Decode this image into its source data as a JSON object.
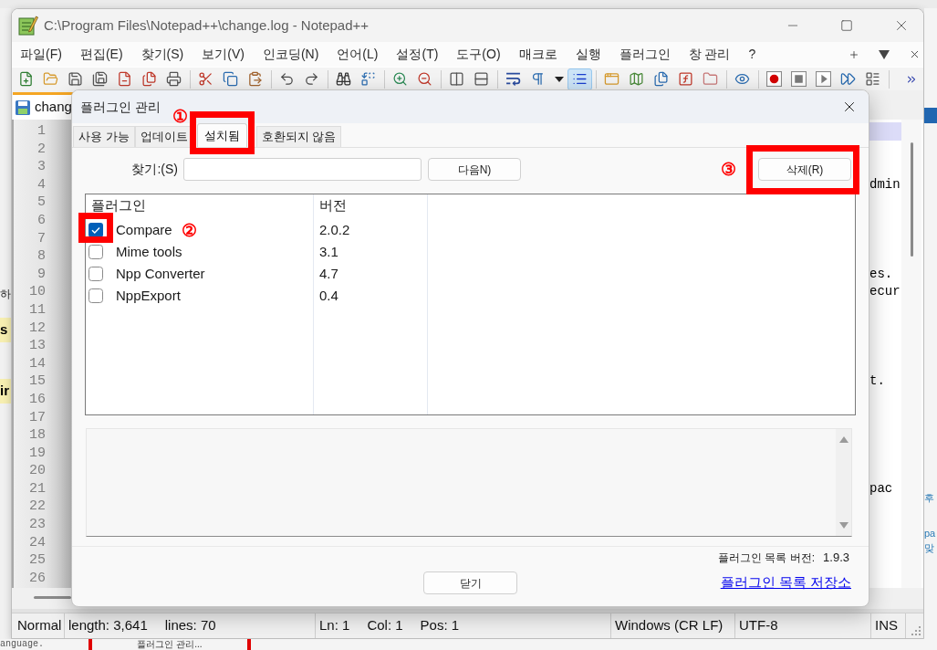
{
  "background": {
    "left_texts": [
      {
        "text": "하",
        "highlighted": false
      },
      {
        "text": "s",
        "highlighted": true
      },
      {
        "text": "ir",
        "highlighted": true
      }
    ],
    "right_texts": [
      "후",
      "pa",
      "맞"
    ],
    "bottom_text": "anguage.",
    "bottom_menu_item": "플러그인 관리..."
  },
  "window": {
    "title": "C:\\Program Files\\Notepad++\\change.log - Notepad++"
  },
  "menu": [
    "파일(F)",
    "편집(E)",
    "찾기(S)",
    "보기(V)",
    "인코딩(N)",
    "언어(L)",
    "설정(T)",
    "도구(O)",
    "매크로",
    "실행",
    "플러그인",
    "창 관리",
    "?"
  ],
  "toolbar": [
    {
      "kind": "button",
      "pressed": false
    },
    {
      "kind": "button",
      "pressed": false
    },
    {
      "kind": "button",
      "pressed": false
    },
    {
      "kind": "button",
      "pressed": false
    },
    {
      "kind": "button",
      "pressed": false
    },
    {
      "kind": "button",
      "pressed": false
    },
    {
      "kind": "button",
      "pressed": false
    },
    {
      "kind": "separator"
    },
    {
      "kind": "button",
      "pressed": false
    },
    {
      "kind": "button",
      "pressed": false
    },
    {
      "kind": "button",
      "pressed": false
    },
    {
      "kind": "separator"
    },
    {
      "kind": "button",
      "pressed": false
    },
    {
      "kind": "button",
      "pressed": false
    },
    {
      "kind": "separator"
    },
    {
      "kind": "button",
      "pressed": false
    },
    {
      "kind": "button",
      "pressed": false
    },
    {
      "kind": "separator"
    },
    {
      "kind": "button",
      "pressed": false
    },
    {
      "kind": "button",
      "pressed": false
    },
    {
      "kind": "separator"
    },
    {
      "kind": "button",
      "pressed": false
    },
    {
      "kind": "button",
      "pressed": false
    },
    {
      "kind": "separator"
    },
    {
      "kind": "button",
      "pressed": false
    },
    {
      "kind": "button",
      "pressed": false
    },
    {
      "kind": "dropdown"
    },
    {
      "kind": "button",
      "pressed": true
    },
    {
      "kind": "separator"
    },
    {
      "kind": "button",
      "pressed": false
    },
    {
      "kind": "button",
      "pressed": false
    },
    {
      "kind": "button",
      "pressed": false
    },
    {
      "kind": "button",
      "pressed": false
    },
    {
      "kind": "button",
      "pressed": false
    },
    {
      "kind": "separator"
    },
    {
      "kind": "button",
      "pressed": false
    },
    {
      "kind": "separator"
    },
    {
      "kind": "button",
      "pressed": false
    },
    {
      "kind": "button",
      "pressed": false
    },
    {
      "kind": "button",
      "pressed": false
    },
    {
      "kind": "button",
      "pressed": false
    },
    {
      "kind": "button",
      "pressed": false
    },
    {
      "kind": "separator"
    },
    {
      "kind": "overflow"
    }
  ],
  "tabs": [
    {
      "label": "chang",
      "selected": true
    }
  ],
  "editor": {
    "lines": [
      {
        "number": "1",
        "current": true
      },
      {
        "number": "2",
        "current": false
      },
      {
        "number": "3",
        "current": false
      },
      {
        "number": "4",
        "current": false,
        "text": "dmin"
      },
      {
        "number": "5",
        "current": false
      },
      {
        "number": "6",
        "current": false
      },
      {
        "number": "7",
        "current": false
      },
      {
        "number": "8",
        "current": false
      },
      {
        "number": "9",
        "current": false,
        "text": "es."
      },
      {
        "number": "10",
        "current": false,
        "text": "ecur"
      },
      {
        "number": "11",
        "current": false
      },
      {
        "number": "12",
        "current": false
      },
      {
        "number": "13",
        "current": false
      },
      {
        "number": "14",
        "current": false
      },
      {
        "number": "15",
        "current": false,
        "text": "t."
      },
      {
        "number": "16",
        "current": false
      },
      {
        "number": "17",
        "current": false
      },
      {
        "number": "18",
        "current": false
      },
      {
        "number": "19",
        "current": false
      },
      {
        "number": "20",
        "current": false
      },
      {
        "number": "21",
        "current": false,
        "text": "pac"
      },
      {
        "number": "22",
        "current": false
      },
      {
        "number": "23",
        "current": false
      },
      {
        "number": "24",
        "current": false
      },
      {
        "number": "25",
        "current": false
      },
      {
        "number": "26",
        "current": false
      }
    ]
  },
  "status_bar": [
    {
      "items": [
        "Normal"
      ]
    },
    {
      "items": [
        "length: 3,641",
        "lines: 70"
      ]
    },
    {
      "items": [
        "Ln: 1",
        "Col: 1",
        "Pos: 1"
      ]
    },
    {
      "items": [
        "Windows (CR LF)"
      ]
    },
    {
      "items": [
        "UTF-8"
      ]
    },
    {
      "items": [
        "INS"
      ]
    }
  ],
  "dialog": {
    "title": "플러그인 관리",
    "tabs": [
      {
        "label": "사용 가능",
        "selected": false,
        "highlighted": false
      },
      {
        "label": "업데이트",
        "selected": false,
        "highlighted": false
      },
      {
        "label": "설치됨",
        "selected": true,
        "highlighted": true,
        "callout": "①"
      },
      {
        "label": "호환되지 않음",
        "selected": false,
        "highlighted": false
      }
    ],
    "search": {
      "label": "찾기:(S)"
    },
    "next_button": {
      "label": "다음N)"
    },
    "remove_button": {
      "label": "삭제(R)",
      "highlighted": true,
      "callout": "③"
    },
    "list": {
      "columns": [
        "플러그인",
        "버전"
      ],
      "rows": [
        {
          "name": "Compare",
          "version": "2.0.2",
          "checked": true,
          "highlighted": true,
          "callout": "②"
        },
        {
          "name": "Mime tools",
          "version": "3.1",
          "checked": false,
          "highlighted": false
        },
        {
          "name": "Npp Converter",
          "version": "4.7",
          "checked": false,
          "highlighted": false
        },
        {
          "name": "NppExport",
          "version": "0.4",
          "checked": false,
          "highlighted": false
        }
      ]
    },
    "list_version": {
      "label": "플러그인 목록 버전:",
      "value": "1.9.3"
    },
    "close_button": {
      "label": "닫기"
    },
    "repository_link": "플러그인 목록 저장소"
  }
}
